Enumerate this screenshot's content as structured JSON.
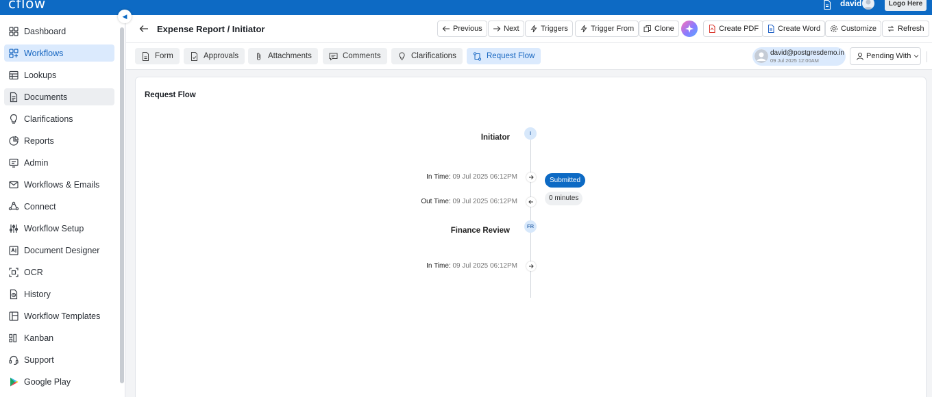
{
  "topbar": {
    "logo": "cflow",
    "user_name": "david",
    "logo_placeholder": "Logo Here"
  },
  "sidebar": {
    "items": [
      {
        "label": "Dashboard",
        "icon": "dashboard-icon"
      },
      {
        "label": "Workflows",
        "icon": "workflows-icon",
        "active": true
      },
      {
        "label": "Lookups",
        "icon": "table-icon"
      },
      {
        "label": "Documents",
        "icon": "document-icon",
        "hover": true
      },
      {
        "label": "Clarifications",
        "icon": "bulb-icon"
      },
      {
        "label": "Reports",
        "icon": "pie-chart-icon"
      },
      {
        "label": "Admin",
        "icon": "admin-icon"
      },
      {
        "label": "Workflows & Emails",
        "icon": "mail-icon"
      },
      {
        "label": "Connect",
        "icon": "connect-icon"
      },
      {
        "label": "Workflow Setup",
        "icon": "sliders-icon"
      },
      {
        "label": "Document Designer",
        "icon": "designer-icon"
      },
      {
        "label": "OCR",
        "icon": "ocr-icon"
      },
      {
        "label": "History",
        "icon": "history-icon"
      },
      {
        "label": "Workflow Templates",
        "icon": "template-icon"
      },
      {
        "label": "Kanban",
        "icon": "kanban-icon"
      },
      {
        "label": "Support",
        "icon": "headset-icon"
      },
      {
        "label": "Google Play",
        "icon": "google-play-icon"
      }
    ]
  },
  "header": {
    "title": "Expense Report / Initiator",
    "buttons": {
      "previous": "Previous",
      "next": "Next",
      "triggers": "Triggers",
      "trigger_from": "Trigger From",
      "clone": "Clone",
      "create_pdf": "Create PDF",
      "create_word": "Create Word",
      "customize": "Customize",
      "refresh": "Refresh"
    }
  },
  "tabs": {
    "form": "Form",
    "approvals": "Approvals",
    "attachments": "Attachments",
    "comments": "Comments",
    "clarifications": "Clarifications",
    "request_flow": "Request Flow"
  },
  "user_chip": {
    "email": "david@postgresdemo.in",
    "date": "09 Jul 2025 12:00AM"
  },
  "pending_with": "Pending With",
  "request_flow": {
    "title": "Request Flow",
    "steps": [
      {
        "name": "Initiator",
        "badge": "I",
        "in_label": "In Time:",
        "in_time": "09 Jul 2025 06:12PM",
        "out_label": "Out Time:",
        "out_time": "09 Jul 2025 06:12PM",
        "status": "Submitted",
        "duration": "0 minutes"
      },
      {
        "name": "Finance Review",
        "badge": "FR",
        "in_label": "In Time:",
        "in_time": "09 Jul 2025 06:12PM"
      }
    ]
  },
  "colors": {
    "brand": "#0d6ac4",
    "active_bg": "#dbeafd",
    "submitted_pill": "#0d6ac4"
  }
}
